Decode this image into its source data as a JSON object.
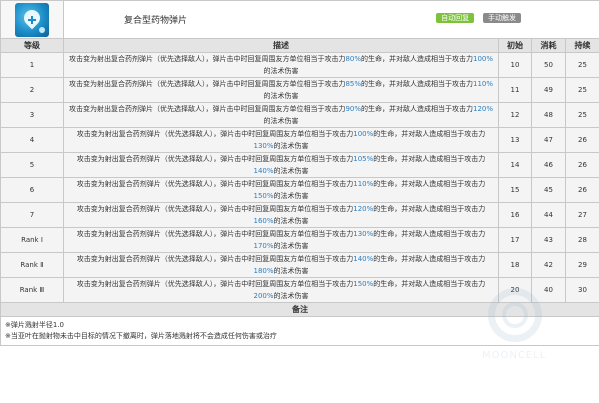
{
  "skill": {
    "name": "复合型药物弹片",
    "icon": "medicine-shard-icon",
    "badges": [
      {
        "label": "自动回复",
        "color": "#7cc33b"
      },
      {
        "label": "手动触发",
        "color": "#8a8a8a"
      }
    ]
  },
  "table": {
    "headers": {
      "level": "等级",
      "desc": "描述",
      "initial": "初始",
      "cost": "消耗",
      "duration": "持续"
    },
    "rows": [
      {
        "level": "1",
        "pre": "攻击变为射出复合药剂弹片（优先选择敌人），弹片击中时回复周围友方单位相当于攻击力",
        "v1": "80%",
        "mid": "的生命，并对敌人造成相当于攻击力",
        "v2": "100%",
        "post": "的法术伤害",
        "initial": "10",
        "cost": "50",
        "duration": "25"
      },
      {
        "level": "2",
        "pre": "攻击变为射出复合药剂弹片（优先选择敌人），弹片击中时回复周围友方单位相当于攻击力",
        "v1": "85%",
        "mid": "的生命，并对敌人造成相当于攻击力",
        "v2": "110%",
        "post": "的法术伤害",
        "initial": "11",
        "cost": "49",
        "duration": "25"
      },
      {
        "level": "3",
        "pre": "攻击变为射出复合药剂弹片（优先选择敌人），弹片击中时回复周围友方单位相当于攻击力",
        "v1": "90%",
        "mid": "的生命，并对敌人造成相当于攻击力",
        "v2": "120%",
        "post": "的法术伤害",
        "initial": "12",
        "cost": "48",
        "duration": "25"
      },
      {
        "level": "4",
        "pre": "攻击变为射出复合药剂弹片（优先选择敌人），弹片击中时回复周围友方单位相当于攻击力",
        "v1": "100%",
        "mid": "的生命，并对敌人造成相当于攻击力",
        "v2": "130%",
        "post": "的法术伤害",
        "initial": "13",
        "cost": "47",
        "duration": "26"
      },
      {
        "level": "5",
        "pre": "攻击变为射出复合药剂弹片（优先选择敌人），弹片击中时回复周围友方单位相当于攻击力",
        "v1": "105%",
        "mid": "的生命，并对敌人造成相当于攻击力",
        "v2": "140%",
        "post": "的法术伤害",
        "initial": "14",
        "cost": "46",
        "duration": "26"
      },
      {
        "level": "6",
        "pre": "攻击变为射出复合药剂弹片（优先选择敌人），弹片击中时回复周围友方单位相当于攻击力",
        "v1": "110%",
        "mid": "的生命，并对敌人造成相当于攻击力",
        "v2": "150%",
        "post": "的法术伤害",
        "initial": "15",
        "cost": "45",
        "duration": "26"
      },
      {
        "level": "7",
        "pre": "攻击变为射出复合药剂弹片（优先选择敌人），弹片击中时回复周围友方单位相当于攻击力",
        "v1": "120%",
        "mid": "的生命，并对敌人造成相当于攻击力",
        "v2": "160%",
        "post": "的法术伤害",
        "initial": "16",
        "cost": "44",
        "duration": "27"
      },
      {
        "level": "Rank Ⅰ",
        "pre": "攻击变为射出复合药剂弹片（优先选择敌人），弹片击中时回复周围友方单位相当于攻击力",
        "v1": "130%",
        "mid": "的生命，并对敌人造成相当于攻击力",
        "v2": "170%",
        "post": "的法术伤害",
        "initial": "17",
        "cost": "43",
        "duration": "28"
      },
      {
        "level": "Rank Ⅱ",
        "pre": "攻击变为射出复合药剂弹片（优先选择敌人），弹片击中时回复周围友方单位相当于攻击力",
        "v1": "140%",
        "mid": "的生命，并对敌人造成相当于攻击力",
        "v2": "180%",
        "post": "的法术伤害",
        "initial": "18",
        "cost": "42",
        "duration": "29"
      },
      {
        "level": "Rank Ⅲ",
        "pre": "攻击变为射出复合药剂弹片（优先选择敌人），弹片击中时回复周围友方单位相当于攻击力",
        "v1": "150%",
        "mid": "的生命，并对敌人造成相当于攻击力",
        "v2": "200%",
        "post": "的法术伤害",
        "initial": "20",
        "cost": "40",
        "duration": "30"
      }
    ]
  },
  "remarks": {
    "header": "备注",
    "lines": [
      "※弹片溅射半径1.0",
      "※当亚叶在抛射物未击中目标的情况下撤离时，弹片落地溅射将不会造成任何伤害或治疗"
    ]
  },
  "watermark": {
    "text": "MOONCELL",
    "icon": "mooncell-logo-icon"
  }
}
